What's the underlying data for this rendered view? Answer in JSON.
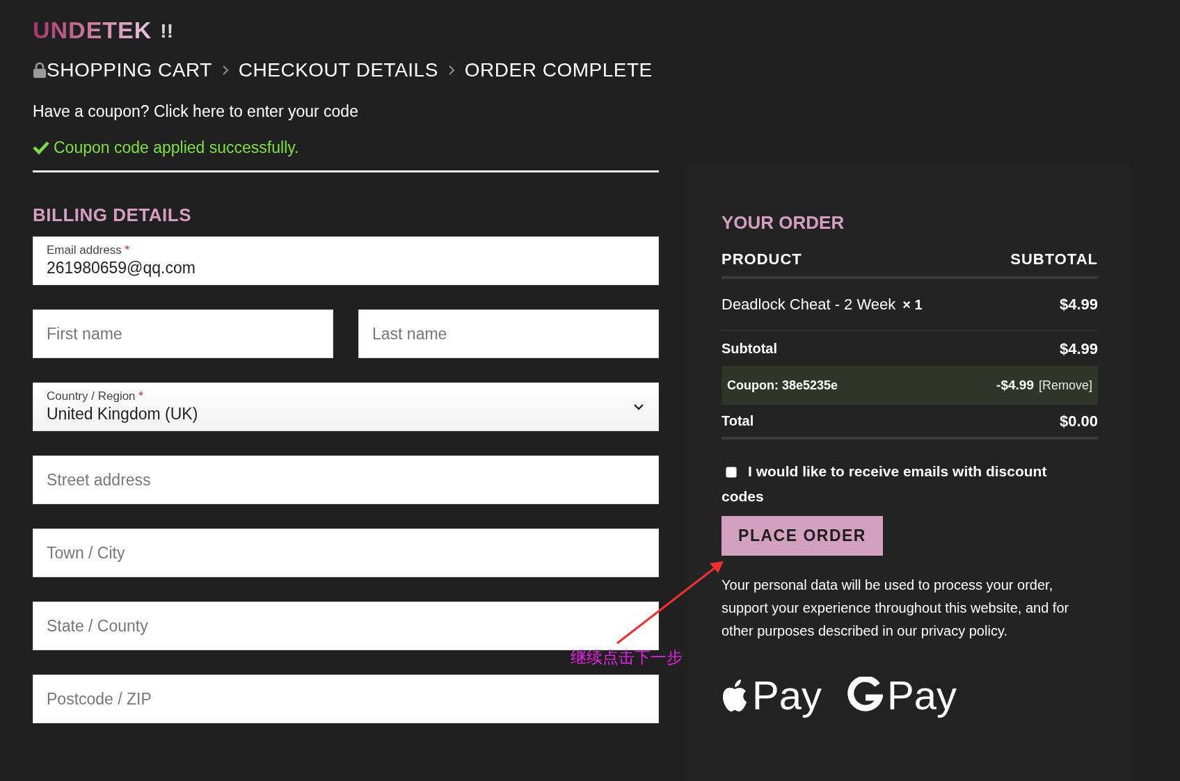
{
  "logo": {
    "name": "UNDETEK",
    "mark": "!!"
  },
  "breadcrumb": [
    {
      "label": "SHOPPING CART",
      "locked": true
    },
    {
      "label": "CHECKOUT DETAILS",
      "locked": false
    },
    {
      "label": "ORDER COMPLETE",
      "locked": false
    }
  ],
  "coupon_prompt": "Have a coupon? Click here to enter your code",
  "notice": {
    "text": "Coupon code applied successfully."
  },
  "billing": {
    "title": "BILLING DETAILS",
    "fields": [
      {
        "kind": "filled",
        "label": "Email address",
        "required": "*",
        "value": "261980659@qq.com"
      },
      {
        "kind": "pair",
        "children": [
          {
            "kind": "empty",
            "placeholder": "First name"
          },
          {
            "kind": "empty",
            "placeholder": "Last name"
          }
        ]
      },
      {
        "kind": "select",
        "label": "Country / Region",
        "required": "*",
        "value": "United Kingdom (UK)"
      },
      {
        "kind": "empty",
        "placeholder": "Street address"
      },
      {
        "kind": "empty",
        "placeholder": "Town / City"
      },
      {
        "kind": "empty",
        "placeholder": "State / County"
      },
      {
        "kind": "empty",
        "placeholder": "Postcode / ZIP"
      }
    ]
  },
  "order": {
    "title": "YOUR ORDER",
    "columns": [
      "PRODUCT",
      "SUBTOTAL"
    ],
    "items": [
      {
        "name": "Deadlock Cheat - 2 Week",
        "quantity": "× 1",
        "price": "$4.99"
      }
    ],
    "subtotal": {
      "label": "Subtotal",
      "value": "$4.99"
    },
    "coupon": {
      "label": "Coupon: 38e5235e",
      "amount": "-$4.99",
      "remove": "[Remove]"
    },
    "total": {
      "label": "Total",
      "value": "$0.00"
    },
    "newsletter": {
      "label": "I would like to receive emails with discount codes",
      "checked": false
    },
    "button": "PLACE ORDER",
    "privacy": "Your personal data will be used to process your order, support your experience throughout this website, and for other purposes described in our privacy policy.",
    "payments": [
      {
        "kind": "apple",
        "label": "Pay"
      },
      {
        "kind": "google",
        "label": "Pay"
      }
    ]
  },
  "annotation": {
    "text": "继续点击下一步"
  }
}
